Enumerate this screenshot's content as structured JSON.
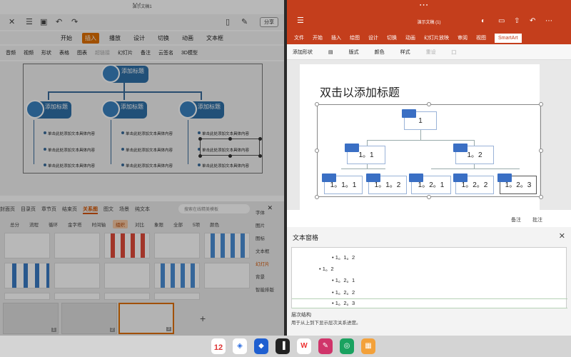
{
  "left": {
    "title": "演示文稿1",
    "share": "分享",
    "tabs": [
      "开始",
      "插入",
      "播放",
      "设计",
      "切换",
      "动画",
      "文本框"
    ],
    "tools": [
      "音频",
      "视频",
      "形状",
      "表格",
      "图表",
      "超链接",
      "幻灯片",
      "备注",
      "云签名",
      "3D模型"
    ],
    "org": {
      "top": "添加标题",
      "heads": [
        "添加标题",
        "添加标题",
        "添加标题"
      ],
      "item": "单击此处添加文本具体内容"
    },
    "cats": [
      "封面页",
      "目录页",
      "章节页",
      "结束页",
      "关系图",
      "图文",
      "场景",
      "纯文本"
    ],
    "search": "搜索在线精美模板",
    "tags": [
      "总分",
      "流程",
      "循环",
      "金字塔",
      "时间轴",
      "组织",
      "对比",
      "象限",
      "全部",
      "5项",
      "颜色"
    ],
    "side": [
      "字体",
      "图片",
      "图标",
      "文本框",
      "幻灯片",
      "背景",
      "智能排版"
    ],
    "slide_nums": [
      "1",
      "2",
      "3"
    ]
  },
  "right": {
    "title": "演示文稿 (1)",
    "tabs": [
      "文件",
      "开始",
      "插入",
      "绘图",
      "设计",
      "切换",
      "动画",
      "幻灯片放映",
      "审阅",
      "视图",
      "SmartArt"
    ],
    "tools": [
      "添加形状",
      "",
      "版式",
      "颜色",
      "样式",
      "重设",
      ""
    ],
    "slide_title": "双击以添加标题",
    "nodes": [
      "1",
      "1。1",
      "1。2",
      "1。1。1",
      "1。1。2",
      "1。2。1",
      "1。2。2",
      "1。2。3"
    ],
    "notes": "备注",
    "comments": "批注",
    "pane_title": "文本窗格",
    "pane_lines": [
      "1。1。2",
      "1。2",
      "1。2。1",
      "1。2。2",
      "1。2。3"
    ],
    "pane_h1": "层次结构",
    "pane_h2": "用于从上到下显示层次关系进度。"
  },
  "dock": {
    "date": "12"
  }
}
